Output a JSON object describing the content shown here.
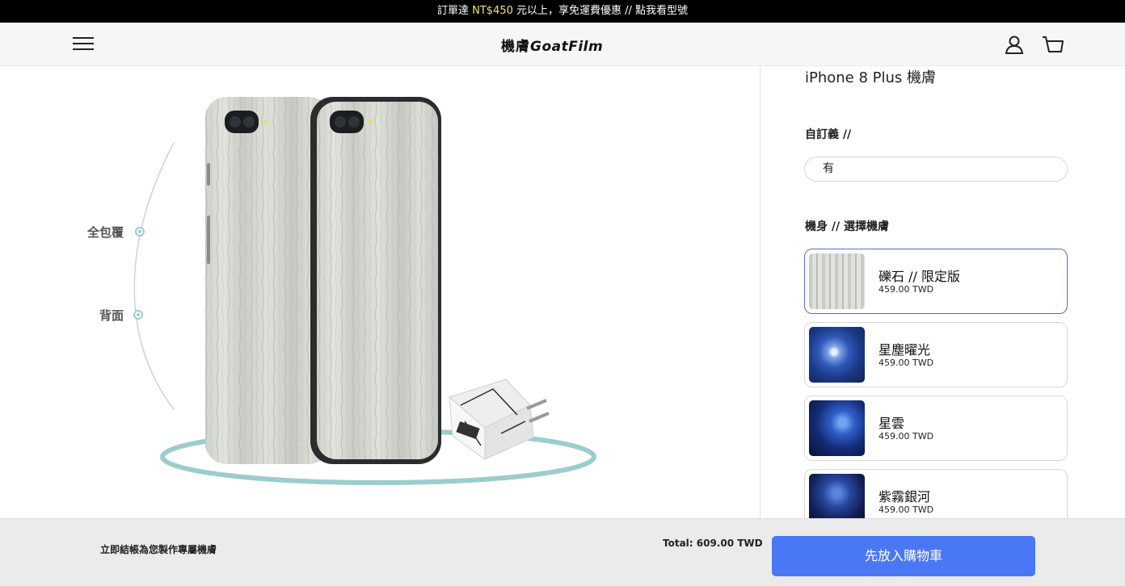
{
  "announcement": {
    "prefix": "訂單達 ",
    "highlight": "NT$450",
    "suffix": " 元以上，享免運費優惠 // 點我看型號",
    "highlight_color": "#f5e663"
  },
  "header": {
    "logo_cjk": "機膚",
    "logo_latin": "GoatFilm",
    "icons": [
      "menu-icon",
      "user-icon",
      "cart-icon"
    ]
  },
  "showcase": {
    "label_full": "全包覆",
    "label_back": "背面",
    "ring_color": "#9ccdcc"
  },
  "product": {
    "title": "iPhone 8 Plus 機膚",
    "custom_label": "自訂義 //",
    "custom_value": "有",
    "body_label": "機身 // 選擇機膚",
    "options": [
      {
        "name": "礫石 // 限定版",
        "price": "459.00 TWD",
        "selected": true,
        "swatch": "marble"
      },
      {
        "name": "星塵曜光",
        "price": "459.00 TWD",
        "selected": false,
        "swatch": "stardust"
      },
      {
        "name": "星雲",
        "price": "459.00 TWD",
        "selected": false,
        "swatch": "nebula"
      },
      {
        "name": "紫霧銀河",
        "price": "459.00 TWD",
        "selected": false,
        "swatch": "galaxy"
      }
    ]
  },
  "footer": {
    "message": "立即結帳為您製作專屬機膚",
    "total": "Total: 609.00 TWD",
    "button": "先放入購物車",
    "button_color": "#4a78f5"
  }
}
